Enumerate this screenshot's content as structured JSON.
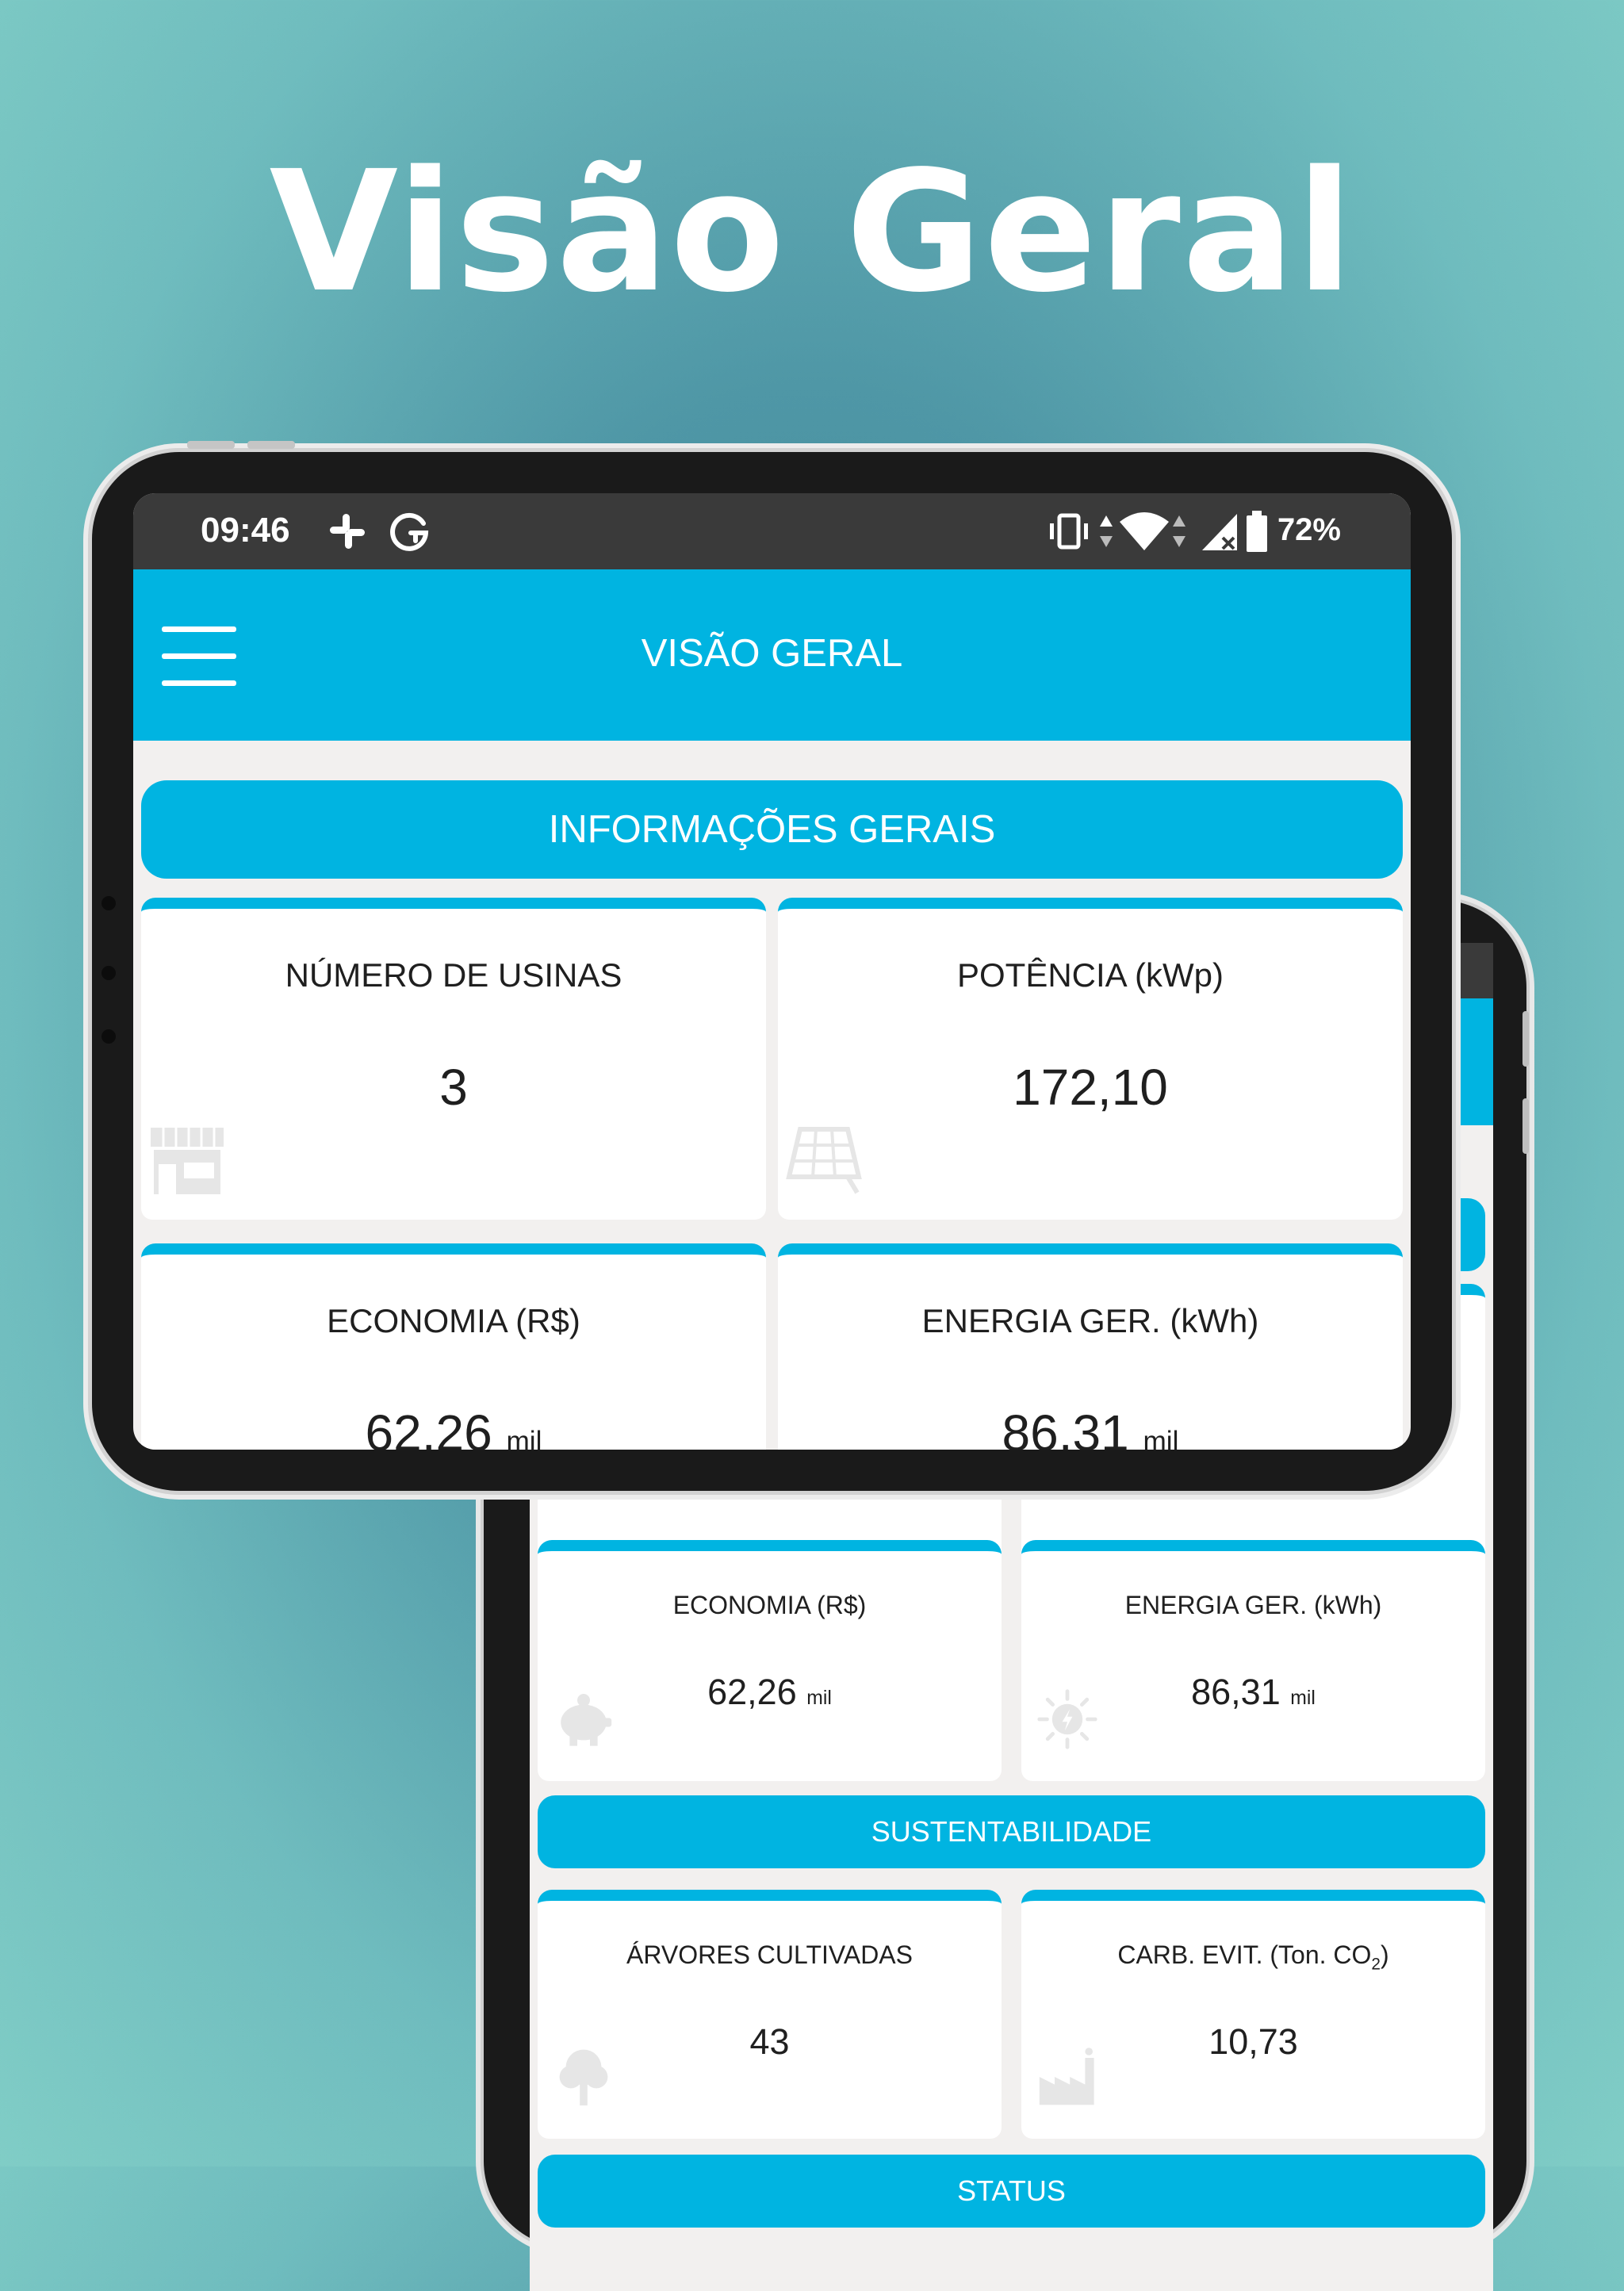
{
  "headline": "Visão Geral",
  "status_bar": {
    "time": "09:46",
    "battery_percent": "72%",
    "icons": [
      "slack-icon",
      "grammarly-icon",
      "vibrate-icon",
      "data-arrows-icon",
      "wifi-icon",
      "signal-icon",
      "battery-icon"
    ]
  },
  "app": {
    "title": "VISÃO GERAL",
    "accent_color": "#00b4e1"
  },
  "sections": {
    "general": "INFORMAÇÕES GERAIS",
    "sustainability": "SUSTENTABILIDADE",
    "status": "STATUS"
  },
  "cards": {
    "usinas": {
      "label": "NÚMERO DE USINAS",
      "value": "3",
      "icon": "store-icon"
    },
    "potencia": {
      "label": "POTÊNCIA (kWp)",
      "value": "172,10",
      "icon": "solar-panel-icon"
    },
    "economia": {
      "label": "ECONOMIA (R$)",
      "value": "62,26",
      "unit": "mil",
      "icon": "piggy-bank-icon"
    },
    "energia": {
      "label": "ENERGIA GER. (kWh)",
      "value": "86,31",
      "unit": "mil",
      "icon": "sun-energy-icon"
    },
    "arvores": {
      "label": "ÁRVORES CULTIVADAS",
      "value": "43",
      "icon": "tree-icon"
    },
    "carbono": {
      "label_prefix": "CARB. EVIT. (Ton. CO",
      "label_sub": "2",
      "label_suffix": ")",
      "value": "10,73",
      "icon": "factory-icon"
    }
  }
}
